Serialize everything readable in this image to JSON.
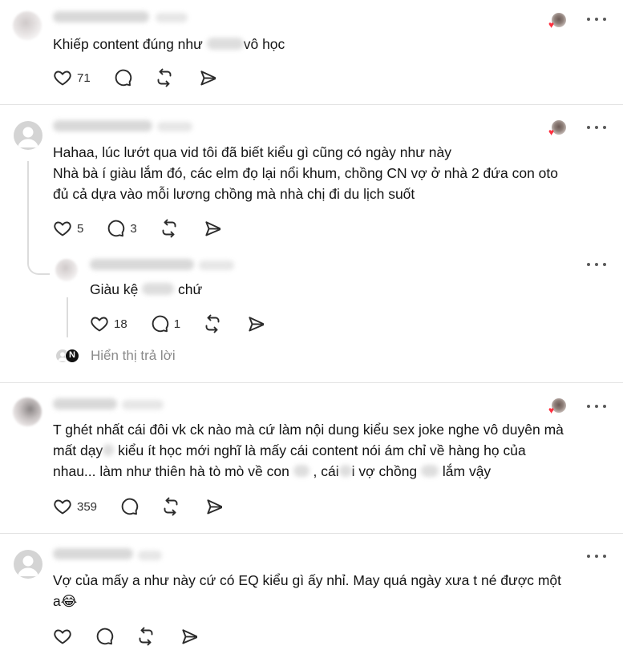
{
  "comments": [
    {
      "text_lines": [
        [
          "Khiếp content đúng như ",
          "vô học"
        ]
      ],
      "likes": "71",
      "replies": ""
    },
    {
      "text_lines": [
        [
          "Hahaa, lúc lướt qua vid tôi đã biết kiểu gì cũng có ngày như này"
        ],
        [
          "Nhà bà í giàu lắm đó, các elm đọ lại nổi khum, chồng CN vợ ở nhà 2 đứa con oto"
        ],
        [
          "đủ cả dựa vào mỗi lương chồng mà nhà chị đi du lịch suốt"
        ]
      ],
      "likes": "5",
      "replies": "3",
      "reply": {
        "text_parts": [
          "Giàu kệ ",
          " chứ"
        ],
        "likes": "18",
        "replies": "1"
      },
      "show_replies_label": "Hiển thị trả lời"
    },
    {
      "text_lines": [
        [
          "T ghét nhất cái đôi vk ck nào mà cứ làm nội dung kiểu sex joke nghe vô duyên mà"
        ],
        [
          "mất dạy",
          " kiểu ít học mới nghĩ là mấy cái content nói ám chỉ về hàng họ của"
        ],
        [
          "nhau... làm như thiên hà tò mò về con ",
          " , cái",
          "i vợ chồng ",
          " lắm vậy"
        ]
      ],
      "likes": "359",
      "replies": ""
    },
    {
      "text_lines": [
        [
          "Vợ của mấy a như này cứ có EQ kiểu gì ấy nhỉ. May quá ngày xưa t né được một"
        ],
        [
          "a😂"
        ]
      ],
      "likes": "",
      "replies": ""
    }
  ],
  "colors": {
    "heart_badge": "#ff3040",
    "divider": "#e3e3e3",
    "muted_text": "#8a8a8a"
  },
  "icons": [
    "heart-icon",
    "comment-icon",
    "repost-icon",
    "share-icon",
    "more-icon",
    "default-avatar-icon"
  ]
}
